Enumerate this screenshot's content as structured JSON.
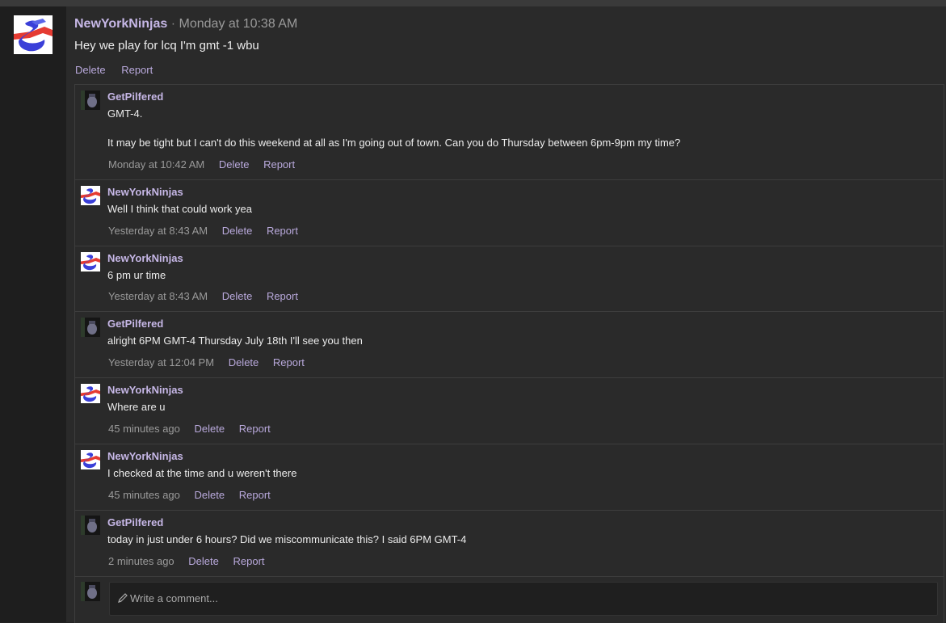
{
  "profile_post": {
    "author": "NewYorkNinjas",
    "separator": "·",
    "time": "Monday at 10:38 AM",
    "body": "Hey we play for lcq I'm gmt -1 wbu",
    "actions": {
      "delete": "Delete",
      "report": "Report"
    }
  },
  "comments": [
    {
      "author": "GetPilfered",
      "lines": [
        "GMT-4.",
        "",
        "It may be tight but I can't do this weekend at all as I'm going out of town. Can you do Thursday between 6pm-9pm my time?"
      ],
      "time": "Monday at 10:42 AM",
      "delete": "Delete",
      "report": "Report",
      "avatar": "getpilfered-avatar"
    },
    {
      "author": "NewYorkNinjas",
      "lines": [
        "Well I think that could work yea"
      ],
      "time": "Yesterday at 8:43 AM",
      "delete": "Delete",
      "report": "Report",
      "avatar": "newyorkninjas-avatar"
    },
    {
      "author": "NewYorkNinjas",
      "lines": [
        "6 pm ur time"
      ],
      "time": "Yesterday at 8:43 AM",
      "delete": "Delete",
      "report": "Report",
      "avatar": "newyorkninjas-avatar"
    },
    {
      "author": "GetPilfered",
      "lines": [
        "alright 6PM GMT-4 Thursday July 18th I'll see you then"
      ],
      "time": "Yesterday at 12:04 PM",
      "delete": "Delete",
      "report": "Report",
      "avatar": "getpilfered-avatar"
    },
    {
      "author": "NewYorkNinjas",
      "lines": [
        "Where are u"
      ],
      "time": "45 minutes ago",
      "delete": "Delete",
      "report": "Report",
      "avatar": "newyorkninjas-avatar"
    },
    {
      "author": "NewYorkNinjas",
      "lines": [
        "I checked at the time and u weren't there"
      ],
      "time": "45 minutes ago",
      "delete": "Delete",
      "report": "Report",
      "avatar": "newyorkninjas-avatar"
    },
    {
      "author": "GetPilfered",
      "lines": [
        "today in just under 6 hours? Did we miscommunicate this? I said 6PM GMT-4"
      ],
      "time": "2 minutes ago",
      "delete": "Delete",
      "report": "Report",
      "avatar": "getpilfered-avatar"
    }
  ],
  "compose": {
    "placeholder": "Write a comment...",
    "icon": "pencil-icon"
  },
  "colors": {
    "background": "#2a2a2a",
    "username": "#c6b7e6",
    "link": "#b9a9dc",
    "muted": "#9a9a9a"
  }
}
